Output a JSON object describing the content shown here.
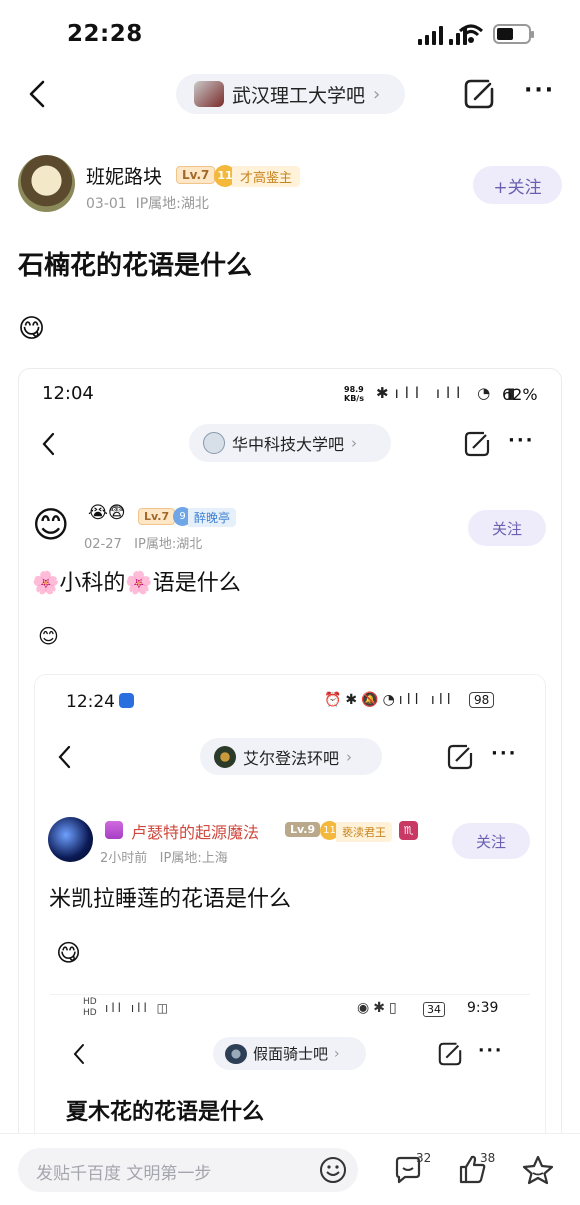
{
  "status": {
    "time": "22:28"
  },
  "header": {
    "forum_name": "武汉理工大学吧"
  },
  "post": {
    "author": "班妮路块",
    "level": "Lv.7",
    "medal_num": "11",
    "medal_label": "才高鉴主",
    "meta": "03-01  IP属地:湖北",
    "follow": "+关注",
    "title": "石楠花的花语是什么",
    "emoji": "😋"
  },
  "inner1": {
    "time": "12:04",
    "net_speed": "98.9 KB/s",
    "battery": "62%",
    "forum_name": "华中科技大学吧",
    "emojis": "😭😨",
    "level": "Lv.7",
    "medal_num": "9",
    "medal_label": "醉晚亭",
    "meta": "02-27   IP属地:湖北",
    "follow": "关注",
    "title": "🌸小科的🌸语是什么",
    "emoji": "😊"
  },
  "inner2": {
    "time": "12:24",
    "battery": "98",
    "forum_name": "艾尔登法环吧",
    "author": "卢瑟特的起源魔法",
    "level": "Lv.9",
    "medal_num": "11",
    "medal_label": "亵渎君王",
    "meta": "2小时前   IP属地:上海",
    "follow": "关注",
    "title": "米凯拉睡莲的花语是什么",
    "emoji": "😋"
  },
  "inner3": {
    "time": "9:39",
    "battery": "34",
    "forum_name": "假面骑士吧",
    "title": "夏木花的花语是什么"
  },
  "bottom": {
    "placeholder": "发贴千百度 文明第一步",
    "comment_count": "32",
    "like_count": "38"
  }
}
